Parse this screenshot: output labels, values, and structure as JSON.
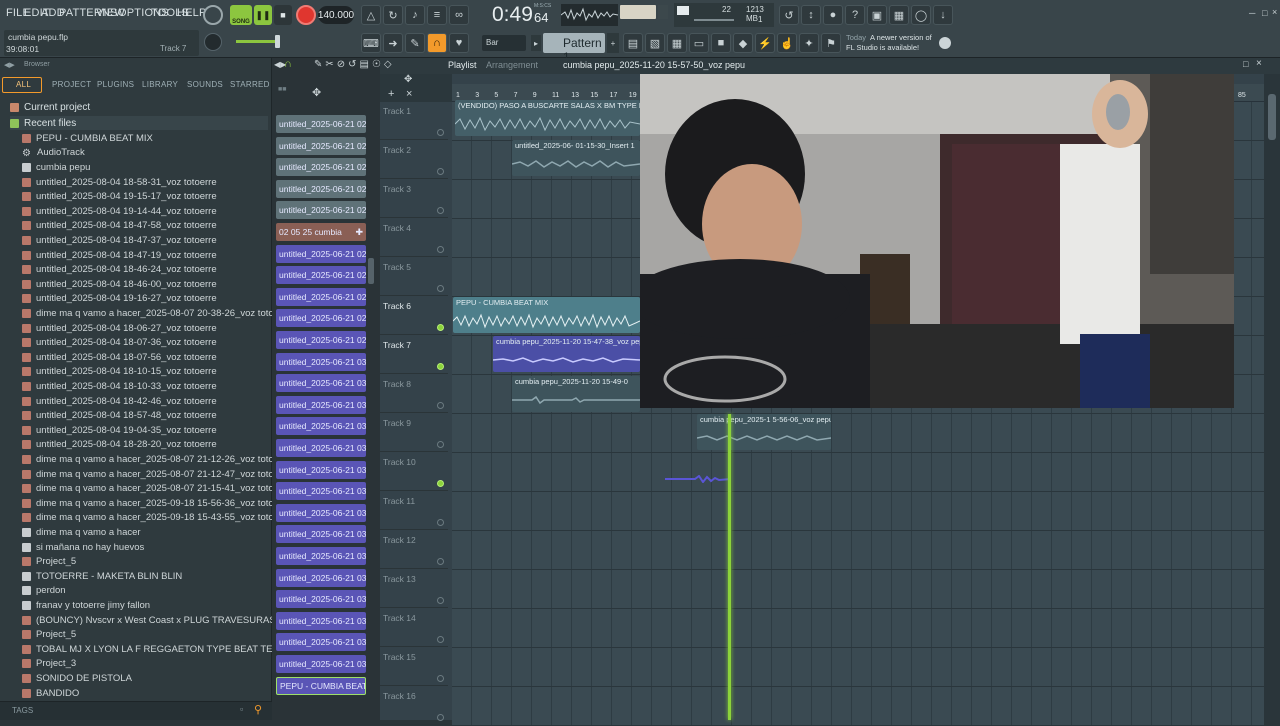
{
  "menu": [
    "FILE",
    "EDIT",
    "ADD",
    "PATTERNS",
    "VIEW",
    "OPTIONS",
    "TOOLS",
    "HELP"
  ],
  "transport": {
    "song_label": "SONG",
    "tempo": "140.000",
    "time": "0:49",
    "time_sub": "64",
    "time_unit": "M:S:CS",
    "cpu_mem": "1213 MB",
    "cpu_num": "22",
    "poly": "1"
  },
  "project": {
    "filename": "cumbia pepu.flp",
    "elapsed": "39:08:01",
    "track_hint": "Track 7"
  },
  "toolbar2": {
    "snap": "Bar",
    "pattern": "Pattern 1"
  },
  "update_notice": {
    "day": "Today",
    "message_line1": "A newer version of",
    "message_line2": "FL Studio is available!"
  },
  "browser": {
    "title": "Browser",
    "tabs": [
      "ALL",
      "PROJECT",
      "PLUGINS",
      "LIBRARY",
      "SOUNDS",
      "STARRED"
    ],
    "sections": [
      "Current project",
      "Recent files"
    ],
    "files": [
      "PEPU - CUMBIA BEAT MIX",
      "AudioTrack",
      "cumbia pepu",
      "untitled_2025-08-04 18-58-31_voz totoerre",
      "untitled_2025-08-04 19-15-17_voz totoerre",
      "untitled_2025-08-04 19-14-44_voz totoerre",
      "untitled_2025-08-04 18-47-58_voz totoerre",
      "untitled_2025-08-04 18-47-37_voz totoerre",
      "untitled_2025-08-04 18-47-19_voz totoerre",
      "untitled_2025-08-04 18-46-24_voz totoerre",
      "untitled_2025-08-04 18-46-00_voz totoerre",
      "untitled_2025-08-04 19-16-27_voz totoerre",
      "dime ma q vamo a  hacer_2025-08-07 20-38-26_voz totoerre",
      "untitled_2025-08-04 18-06-27_voz totoerre",
      "untitled_2025-08-04 18-07-36_voz totoerre",
      "untitled_2025-08-04 18-07-56_voz totoerre",
      "untitled_2025-08-04 18-10-15_voz totoerre",
      "untitled_2025-08-04 18-10-33_voz totoerre",
      "untitled_2025-08-04 18-42-46_voz totoerre",
      "untitled_2025-08-04 18-57-48_voz totoerre",
      "untitled_2025-08-04 19-04-35_voz totoerre",
      "untitled_2025-08-04 18-28-20_voz totoerre",
      "dime ma q vamo a  hacer_2025-08-07 21-12-26_voz totoerre",
      "dime ma q vamo a  hacer_2025-08-07 21-12-47_voz totoerre",
      "dime ma q vamo a  hacer_2025-08-07 21-15-41_voz totoerre",
      "dime ma q vamo a  hacer_2025-09-18 15-56-36_voz totoerre",
      "dime ma q vamo a  hacer_2025-09-18 15-43-55_voz totoerre",
      "dime ma q vamo a  hacer",
      "si mañana no hay huevos",
      "Project_5",
      "TOTOERRE - MAKETA BLIN BLIN",
      "perdon",
      "franav y totoerre jimy fallon",
      "(BOUNCY) Nvscvr x West Coast x PLUG TRAVESURAS Type Beat",
      "Project_5",
      "TOBAL MJ X LYON LA F REGGAETON TYPE BEAT TE ROBE",
      "Project_3",
      "SONIDO DE PISTOLA",
      "BANDIDO"
    ],
    "tags_label": "TAGS"
  },
  "channels": [
    "untitled_2025-06-21 02-",
    "untitled_2025-06-21 02-",
    "untitled_2025-06-21 02-",
    "untitled_2025-06-21 02-",
    "untitled_2025-06-21 02-",
    "02 05 25 cumbia",
    "untitled_2025-06-21 02-",
    "untitled_2025-06-21 02-",
    "untitled_2025-06-21 02-",
    "untitled_2025-06-21 02-",
    "untitled_2025-06-21 02-",
    "untitled_2025-06-21 03-",
    "untitled_2025-06-21 03-",
    "untitled_2025-06-21 03-",
    "untitled_2025-06-21 03-",
    "untitled_2025-06-21 03-",
    "untitled_2025-06-21 03-",
    "untitled_2025-06-21 03-",
    "untitled_2025-06-21 03-",
    "untitled_2025-06-21 03-",
    "untitled_2025-06-21 03-",
    "untitled_2025-06-21 03-",
    "untitled_2025-06-21 03-",
    "untitled_2025-06-21 03-",
    "untitled_2025-06-21 03-",
    "untitled_2025-06-21 03-",
    "PEPU - CUMBIA BEAT..."
  ],
  "playlist": {
    "title": "Playlist",
    "subtitle": "Arrangement",
    "pattern_name": "cumbia pepu_2025-11-20 15-57-50_voz pepu",
    "bars": [
      "1",
      "3",
      "5",
      "7",
      "9",
      "11",
      "13",
      "15",
      "17",
      "19",
      "85"
    ],
    "tracks": [
      "Track 1",
      "Track 2",
      "Track 3",
      "Track 4",
      "Track 5",
      "Track 6",
      "Track 7",
      "Track 8",
      "Track 9",
      "Track 10",
      "Track 11",
      "Track 12",
      "Track 13",
      "Track 14",
      "Track 15",
      "Track 16"
    ],
    "clips": [
      {
        "label": "(VENDIDO) PASO A BUSCARTE SALAS X BM TYPE BEAT"
      },
      {
        "label": "untitled_2025-06-  01-15-30_Insert 1"
      },
      {
        "label": "PEPU - CUMBIA BEAT MIX"
      },
      {
        "label": "cumbia pepu_2025-11-20 15-47-38_voz pepu"
      },
      {
        "label": "cumbia pepu_2025-11-20 15-49-0"
      },
      {
        "label": "cumbia pepu_2025-1 5-56-06_voz pepu"
      }
    ]
  },
  "colors": {
    "accent_orange": "#f39a2b",
    "channel_purple": "#5a55b6",
    "playhead_green": "#8cd33b",
    "clip_teal": "#4e7f8b",
    "record_red": "#e0362f"
  }
}
